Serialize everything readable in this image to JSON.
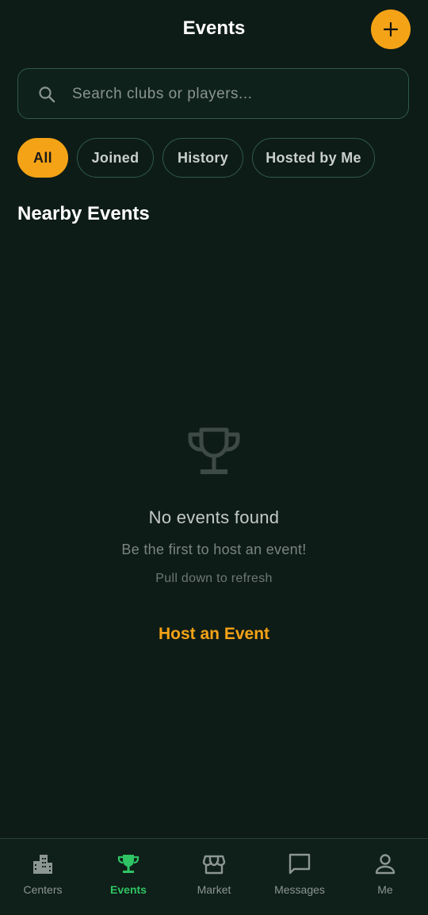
{
  "header": {
    "title": "Events",
    "add_icon": "plus-icon"
  },
  "search": {
    "placeholder": "Search clubs or players...",
    "value": "",
    "icon": "search-icon"
  },
  "filters": [
    {
      "label": "All",
      "active": true
    },
    {
      "label": "Joined",
      "active": false
    },
    {
      "label": "History",
      "active": false
    },
    {
      "label": "Hosted by Me",
      "active": false
    }
  ],
  "section": {
    "title": "Nearby Events"
  },
  "empty_state": {
    "icon": "trophy-icon",
    "title": "No events found",
    "subtitle": "Be the first to host an event!",
    "hint": "Pull down to refresh",
    "action_label": "Host an Event"
  },
  "bottom_nav": [
    {
      "label": "Centers",
      "icon": "buildings-icon",
      "active": false
    },
    {
      "label": "Events",
      "icon": "trophy-icon",
      "active": true
    },
    {
      "label": "Market",
      "icon": "storefront-icon",
      "active": false
    },
    {
      "label": "Messages",
      "icon": "chat-bubble-icon",
      "active": false
    },
    {
      "label": "Me",
      "icon": "person-icon",
      "active": false
    }
  ],
  "colors": {
    "background": "#0e1c17",
    "accent": "#f5a316",
    "active_nav": "#2fc464",
    "border": "#2f5b48"
  }
}
